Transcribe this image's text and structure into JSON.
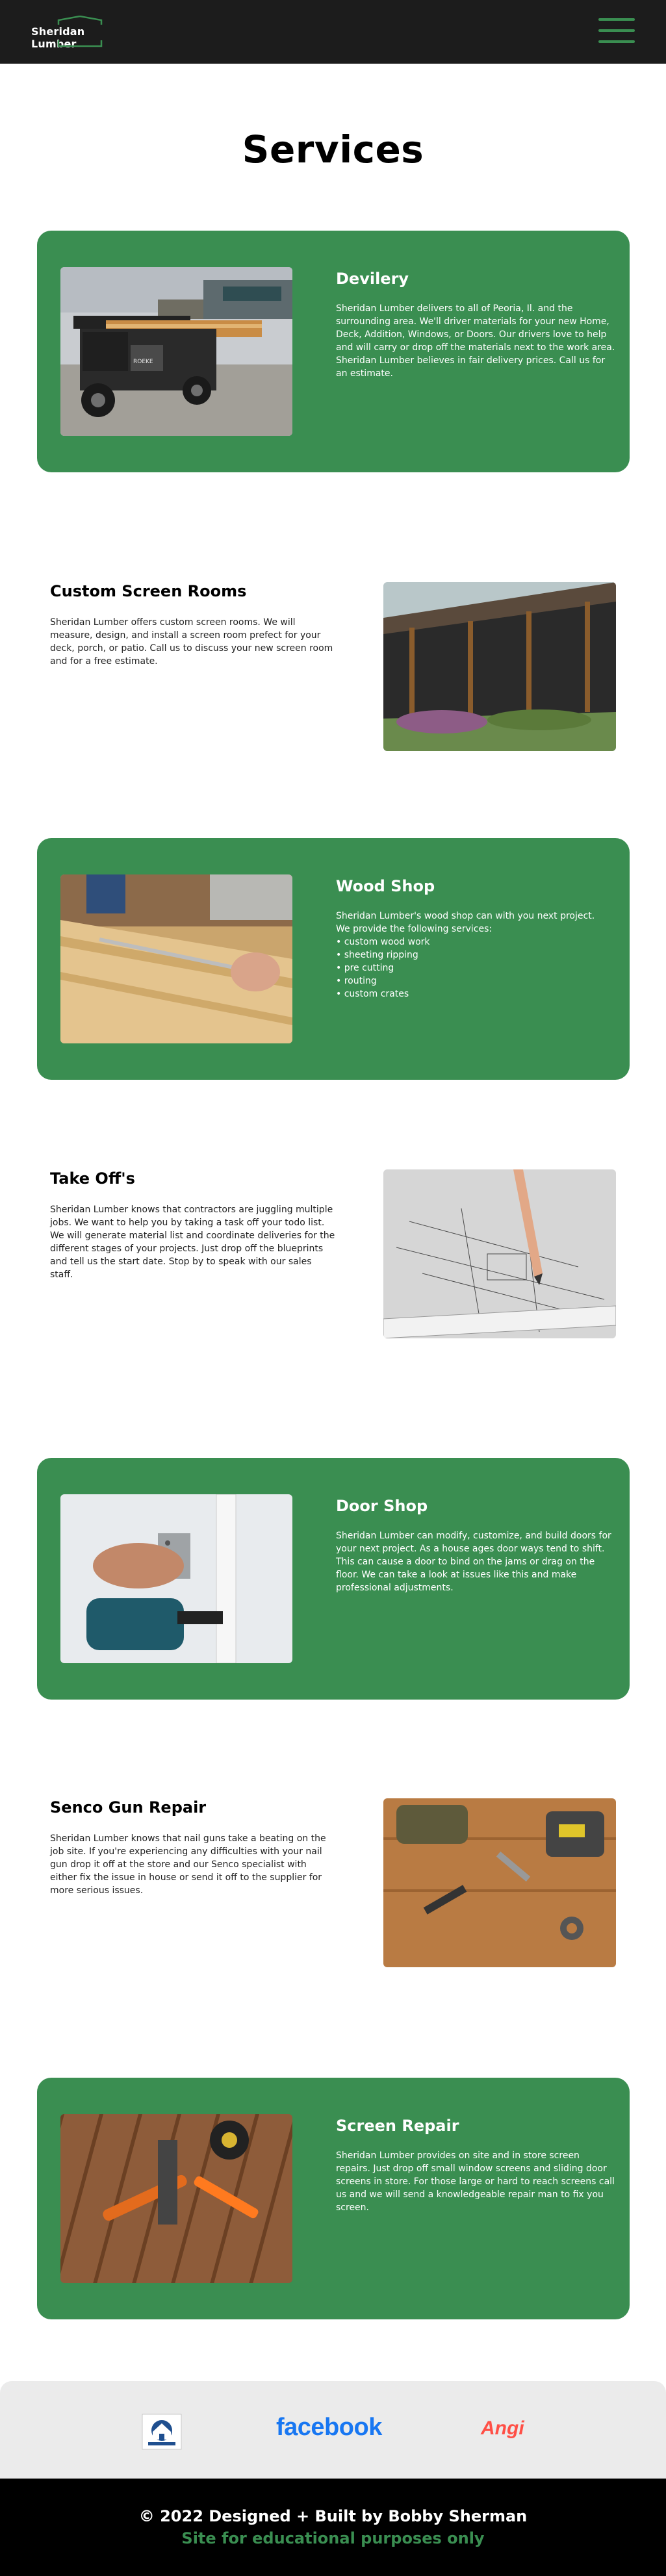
{
  "header": {
    "logo_text": "Sheridan Lumber",
    "menu_icon": "hamburger-menu-icon"
  },
  "page_title": "Services",
  "services": {
    "delivery": {
      "title": "Devilery",
      "text": "Sheridan Lumber delivers to all of Peoria, Il. and the surrounding area. We'll driver materials for your new Home, Deck, Addition, Windows, or Doors. Our drivers love to help and will carry or drop off the materials next to the work area. Sheridan Lumber believes in fair delivery prices. Call us for an estimate.",
      "truck_plate": "ROEKE"
    },
    "screen_rooms": {
      "title": "Custom Screen Rooms",
      "text": "Sheridan Lumber offers custom screen rooms. We will measure, design, and install a screen room prefect for your deck, porch, or patio. Call us to discuss your new screen room and for a free estimate."
    },
    "wood_shop": {
      "title": "Wood Shop",
      "text": "Sheridan Lumber's wood shop can with you next project.\nWe provide the following services:\n• custom wood work\n• sheeting ripping\n• pre cutting\n• routing\n• custom crates"
    },
    "take_offs": {
      "title": "Take Off's",
      "text": "Sheridan Lumber knows that contractors are juggling multiple jobs. We want to help you by taking a task off your todo list. We will generate material list and coordinate deliveries for the different stages of your projects. Just drop off the blueprints and tell us the start date. Stop by to speak with our sales staff."
    },
    "door_shop": {
      "title": "Door Shop",
      "text": "Sheridan Lumber can modify, customize, and build doors for your next project. As a house ages door ways tend to shift. This can cause a door to bind on the jams or drag on the floor. We can take a look at issues like this and make professional adjustments."
    },
    "senco": {
      "title": "Senco Gun Repair",
      "text": "Sheridan Lumber knows that nail guns take a beating on the job site. If you're experiencing any difficulties with your nail gun drop it off at the store and our Senco specialist with either fix the issue in house or send it off to the supplier for more serious issues."
    },
    "screen_repair": {
      "title": "Screen Repair",
      "text": "Sheridan Lumber provides on site and in store screen repairs. Just drop off small window screens and sliding door screens in store. For those large or hard to reach screens call us and we will send a knowledgeable repair man to fix you screen."
    }
  },
  "partners": {
    "facebook": "facebook",
    "angi": "Angi",
    "badge_icon": "association-badge-icon"
  },
  "footer": {
    "copyright": "© 2022 Designed + Built by Bobby Sherman",
    "disclaimer": "Site for educational purposes only"
  },
  "colors": {
    "brand_green": "#3a8e51",
    "header_bg": "#1c1c1c",
    "footer_bg": "#000000",
    "partners_bg": "#ebebeb"
  }
}
